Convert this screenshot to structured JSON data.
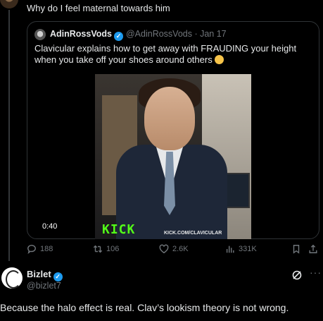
{
  "parent_tweet": {
    "text": "Why do I feel maternal towards him"
  },
  "quoted_tweet": {
    "display_name": "AdinRossVods",
    "handle_date": "@AdinRossVods · Jan 17",
    "text": "Clavicular explains how to get away with FRAUDING your height when you take off your shoes around others",
    "video": {
      "duration": "0:40",
      "overlay_logo": "KICK",
      "overlay_url": "KICK.COM/CLAVICULAR"
    }
  },
  "actions": {
    "replies": "188",
    "reposts": "106",
    "likes": "2.6K",
    "views": "331K"
  },
  "reply": {
    "display_name": "Bizlet",
    "handle": "@bizlet7",
    "text": "Because the halo effect is real. Clav’s lookism theory is not wrong.",
    "more_label": "···"
  },
  "colors": {
    "accent": "#1d9bf0",
    "muted": "#71767b",
    "kick_green": "#53fc18"
  }
}
